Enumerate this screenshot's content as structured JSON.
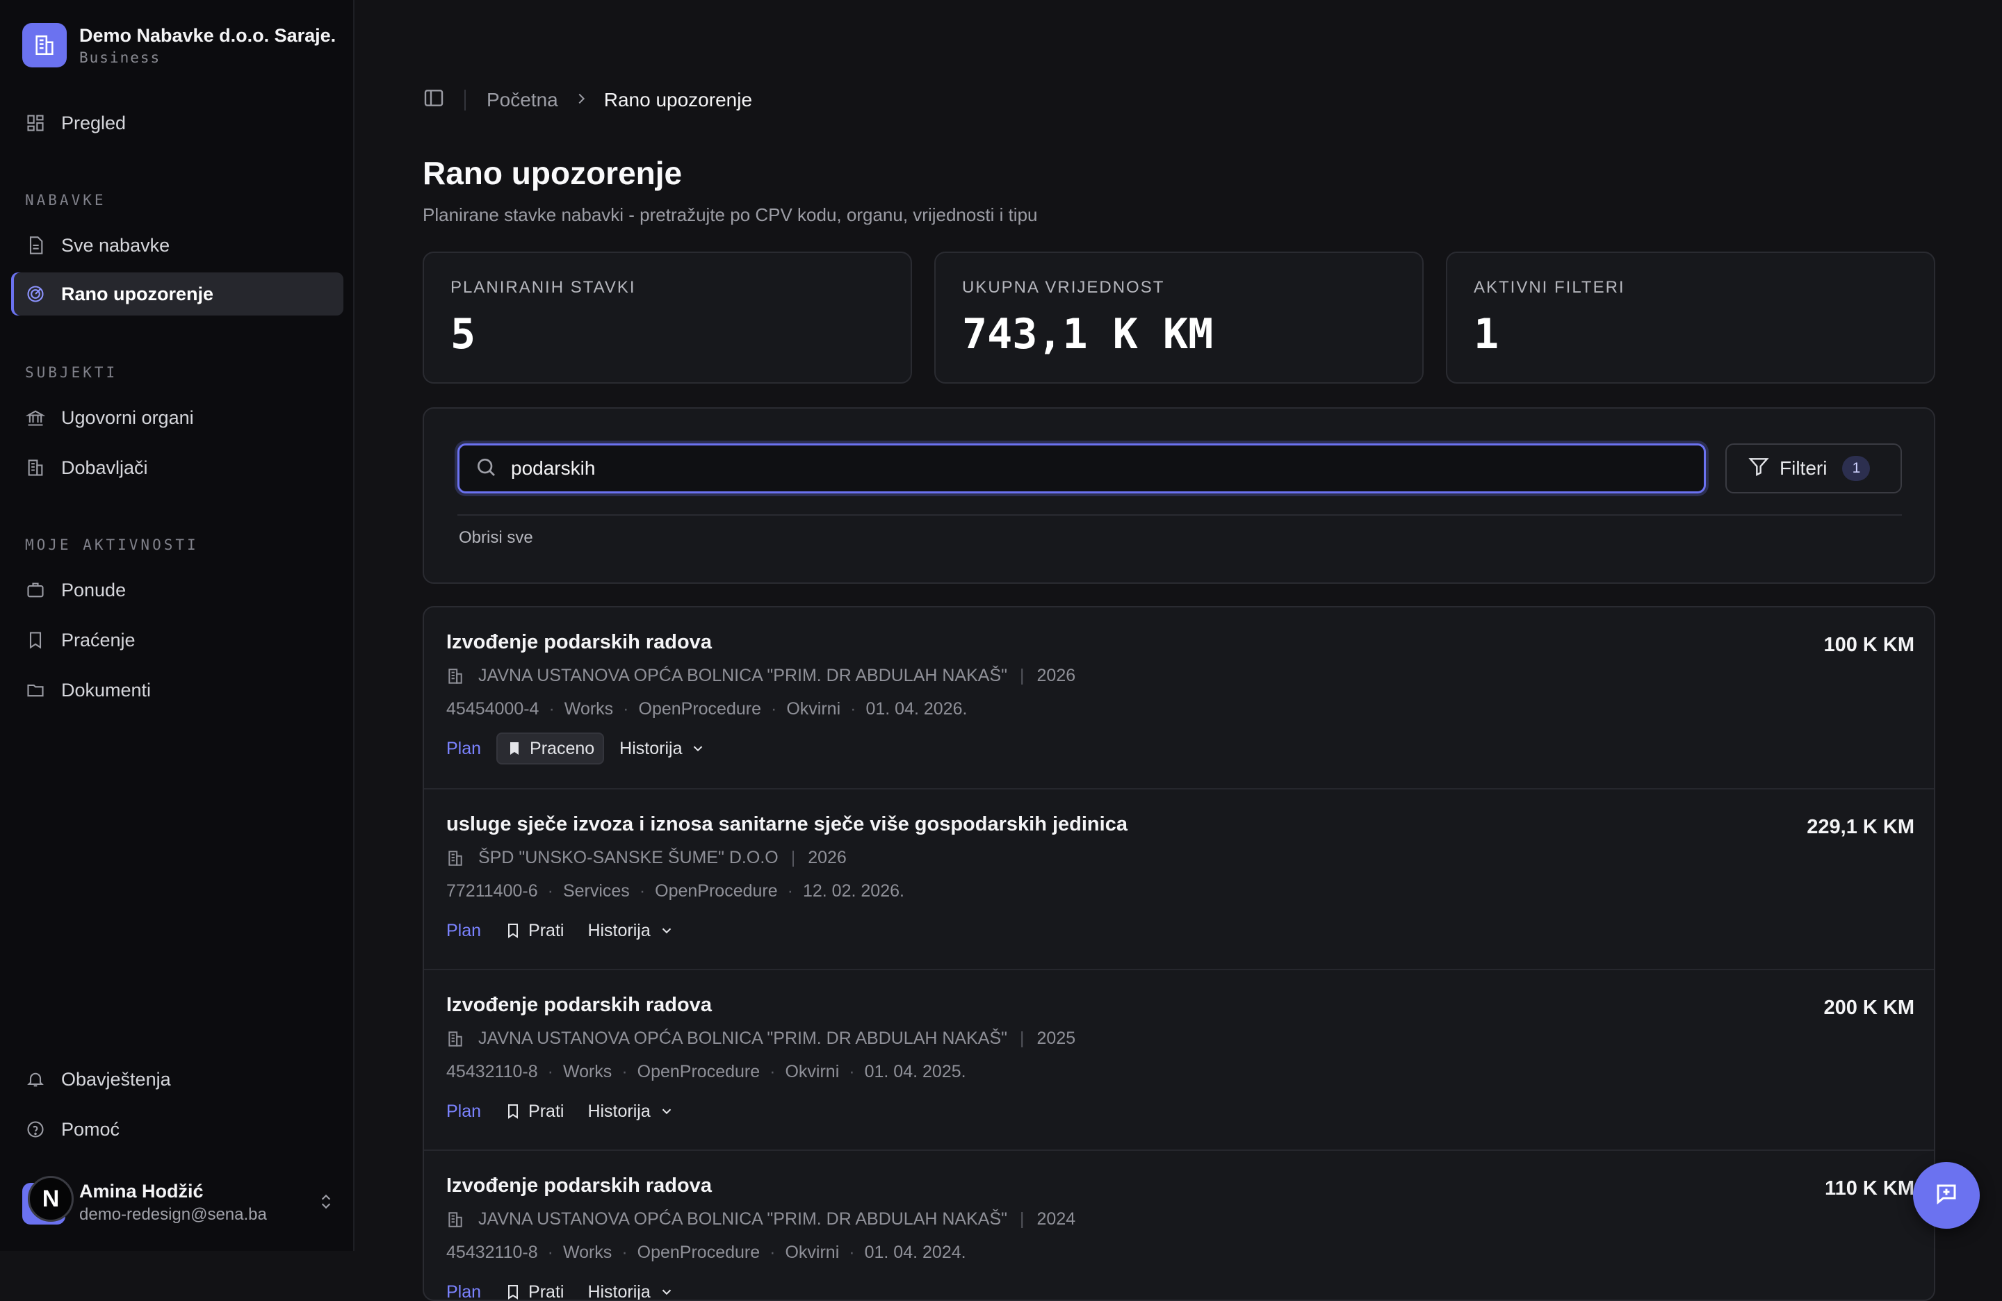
{
  "org": {
    "name": "Demo Nabavke d.o.o. Saraje...",
    "plan": "Business",
    "icon": "building-icon"
  },
  "sidebar": {
    "overview": "Pregled",
    "section_procurement": "NABAVKE",
    "all_procurements": "Sve nabavke",
    "early_warning": "Rano upozorenje",
    "section_subjects": "SUBJEKTI",
    "contracting_authorities": "Ugovorni organi",
    "suppliers": "Dobavljači",
    "section_activities": "MOJE AKTIVNOSTI",
    "offers": "Ponude",
    "tracking": "Praćenje",
    "documents": "Dokumenti",
    "notifications": "Obavještenja",
    "help": "Pomoć"
  },
  "user": {
    "initial": "N",
    "name": "Amina Hodžić",
    "email": "demo-redesign@sena.ba"
  },
  "breadcrumb": {
    "home": "Početna",
    "current": "Rano upozorenje"
  },
  "page": {
    "title": "Rano upozorenje",
    "subtitle": "Planirane stavke nabavki - pretražujte po CPV kodu, organu, vrijednosti i tipu"
  },
  "stats": [
    {
      "label": "PLANIRANIH STAVKI",
      "value": "5"
    },
    {
      "label": "UKUPNA VRIJEDNOST",
      "value": "743,1 K KM"
    },
    {
      "label": "AKTIVNI FILTERI",
      "value": "1"
    }
  ],
  "search": {
    "value": "podarskih",
    "placeholder": "",
    "filter_label": "Filteri",
    "filter_count": "1",
    "clear_all": "Obrisi sve"
  },
  "items": [
    {
      "title": "Izvođenje podarskih radova",
      "amount": "100 K KM",
      "authority": "JAVNA USTANOVA OPĆA BOLNICA \"PRIM. DR ABDULAH NAKAŠ\"",
      "year": "2026",
      "cpv": "45454000-4",
      "type": "Works",
      "procedure": "OpenProcedure",
      "contract": "Okvirni",
      "date": "01. 04. 2026.",
      "tag": "Plan",
      "follow_label": "Praceno",
      "followed": true,
      "history": "Historija"
    },
    {
      "title": "usluge sječe izvoza i iznosa sanitarne sječe više gospodarskih jedinica",
      "amount": "229,1 K KM",
      "authority": "ŠPD \"UNSKO-SANSKE ŠUME\" D.O.O",
      "year": "2026",
      "cpv": "77211400-6",
      "type": "Services",
      "procedure": "OpenProcedure",
      "contract": "",
      "date": "12. 02. 2026.",
      "tag": "Plan",
      "follow_label": "Prati",
      "followed": false,
      "history": "Historija"
    },
    {
      "title": "Izvođenje podarskih radova",
      "amount": "200 K KM",
      "authority": "JAVNA USTANOVA OPĆA BOLNICA \"PRIM. DR ABDULAH NAKAŠ\"",
      "year": "2025",
      "cpv": "45432110-8",
      "type": "Works",
      "procedure": "OpenProcedure",
      "contract": "Okvirni",
      "date": "01. 04. 2025.",
      "tag": "Plan",
      "follow_label": "Prati",
      "followed": false,
      "history": "Historija"
    },
    {
      "title": "Izvođenje podarskih radova",
      "amount": "110 K KM",
      "authority": "JAVNA USTANOVA OPĆA BOLNICA \"PRIM. DR ABDULAH NAKAŠ\"",
      "year": "2024",
      "cpv": "45432110-8",
      "type": "Works",
      "procedure": "OpenProcedure",
      "contract": "Okvirni",
      "date": "01. 04. 2024.",
      "tag": "Plan",
      "follow_label": "Prati",
      "followed": false,
      "history": "Historija"
    }
  ],
  "colors": {
    "accent": "#6b72f0",
    "background": "#121215",
    "sidebar": "#0c0c0f",
    "card": "#17181c"
  }
}
